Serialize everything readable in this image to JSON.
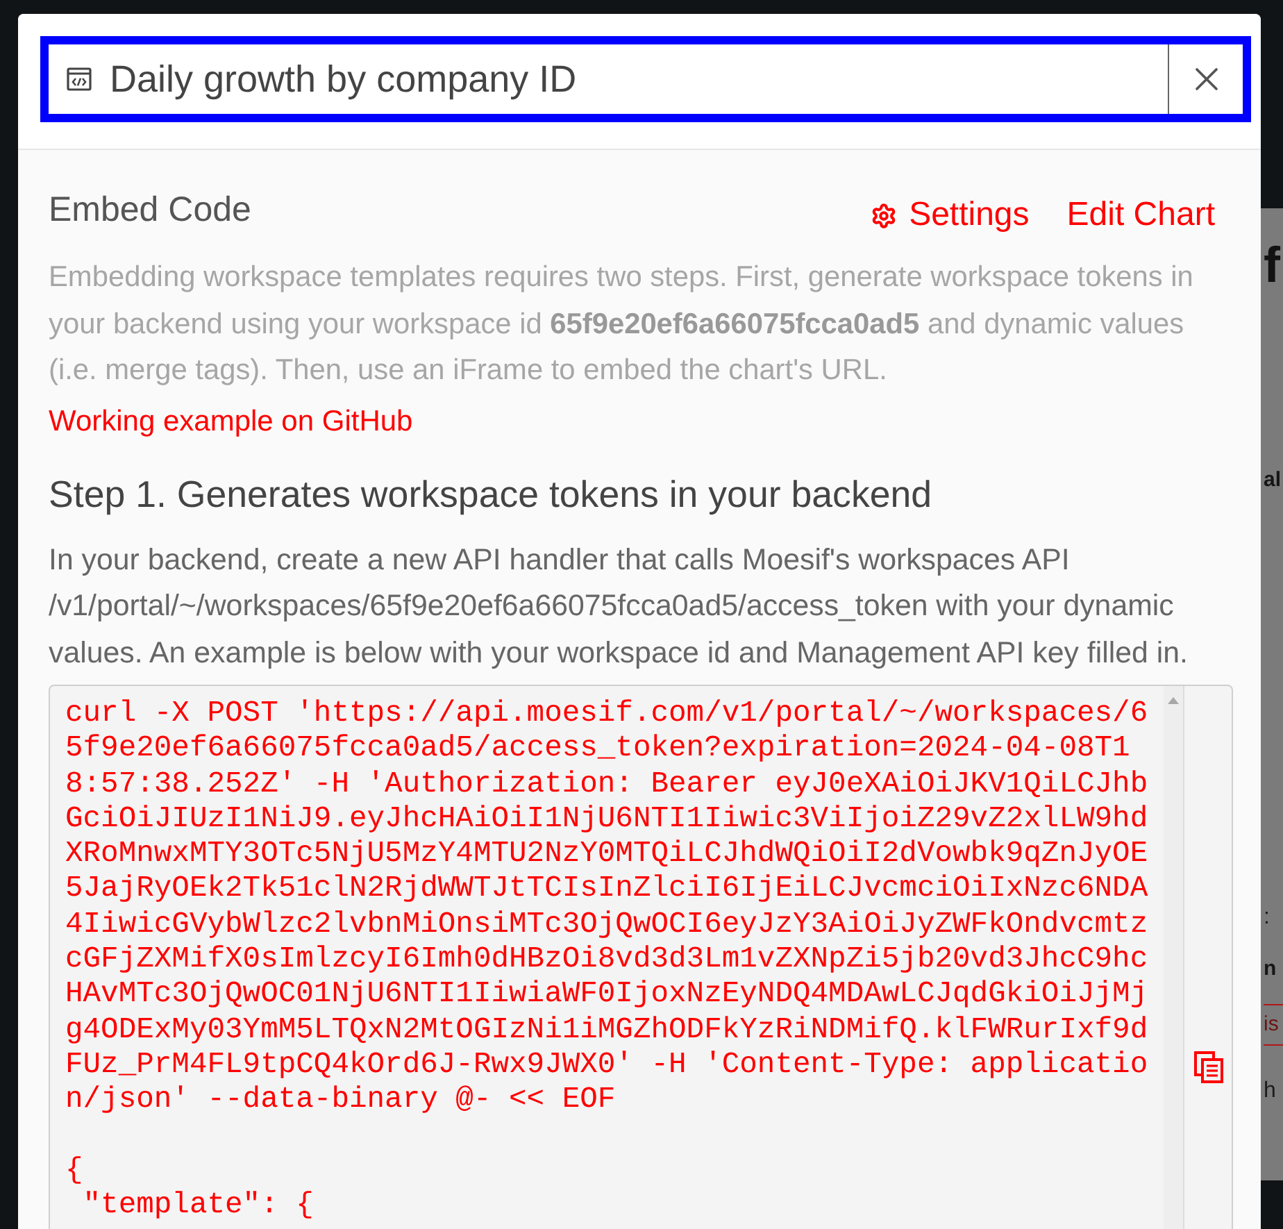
{
  "dialog": {
    "title_field": {
      "value": "Daily growth by company ID",
      "focused": true
    }
  },
  "embed": {
    "heading": "Embed Code",
    "actions": [
      {
        "kind": "settings",
        "label": "Settings"
      },
      {
        "kind": "link",
        "label": "Edit Chart"
      }
    ],
    "intro": "Embedding workspace templates requires two steps. First, generate workspace tokens in your backend using your workspace id **65f9e20ef6a66075fcca0ad5** and dynamic values (i.e. merge tags). Then, use an iFrame to embed the chart's URL.",
    "github_link": "Working example on GitHub"
  },
  "step_1": {
    "heading": "Step 1. Generates workspace tokens in your backend",
    "description": "In your backend, create a new API handler that calls Moesif's workspaces API /v1/portal/~/workspaces/65f9e20ef6a66075fcca0ad5/access_token with your dynamic values. An example is below with your workspace id and Management API key filled in.",
    "code": "curl -X POST 'https://api.moesif.com/v1/portal/~/workspaces/6\n5f9e20ef6a66075fcca0ad5/access_token?expiration=2024-04-08T1\n8:57:38.252Z' -H 'Authorization: Bearer eyJ0eXAiOiJKV1QiLCJhb\nGciOiJIUzI1NiJ9.eyJhcHAiOiI1NjU6NTI1Iiwic3ViIjoiZ29vZ2xlLW9hd\nXRoMnwxMTY3OTc5NjU5MzY4MTU2NzY0MTQiLCJhdWQiOiI2dVowbk9qZnJyOE\n5JajRyOEk2Tk51clN2RjdWWTJtTCIsInZlciI6IjEiLCJvcmciOiIxNzc6NDA\n4IiwicGVybWlzc2lvbnMiOnsiMTc3OjQwOCI6eyJzY3AiOiJyZWFkOndvcmtz\ncGFjZXMifX0sImlzcyI6Imh0dHBzOi8vd3d3Lm1vZXNpZi5jb20vd3JhcC9hc\nHAvMTc3OjQwOC01NjU6NTI1IiwiaWF0IjoxNzEyNDQ4MDAwLCJqdGkiOiJjMj\ng4ODExMy03YmM5LTQxN2MtOGIzNi1iMGZhODFkYzRiNDMifQ.klFWRurIxf9d\nFUz_PrM4FL9tpCQ4kOrd6J-Rwx9JWX0' -H 'Content-Type: applicatio\nn/json' --data-binary @- << EOF\n\n{\n \"template\": {"
  },
  "backdrop": {
    "fragments": [
      {
        "kind": "heading",
        "text": "f"
      },
      {
        "kind": "label",
        "text": "al"
      },
      {
        "kind": "text",
        "text": ":"
      },
      {
        "kind": "label",
        "text": "n"
      },
      {
        "kind": "field",
        "text": "is"
      },
      {
        "kind": "text",
        "text": "h"
      }
    ]
  }
}
